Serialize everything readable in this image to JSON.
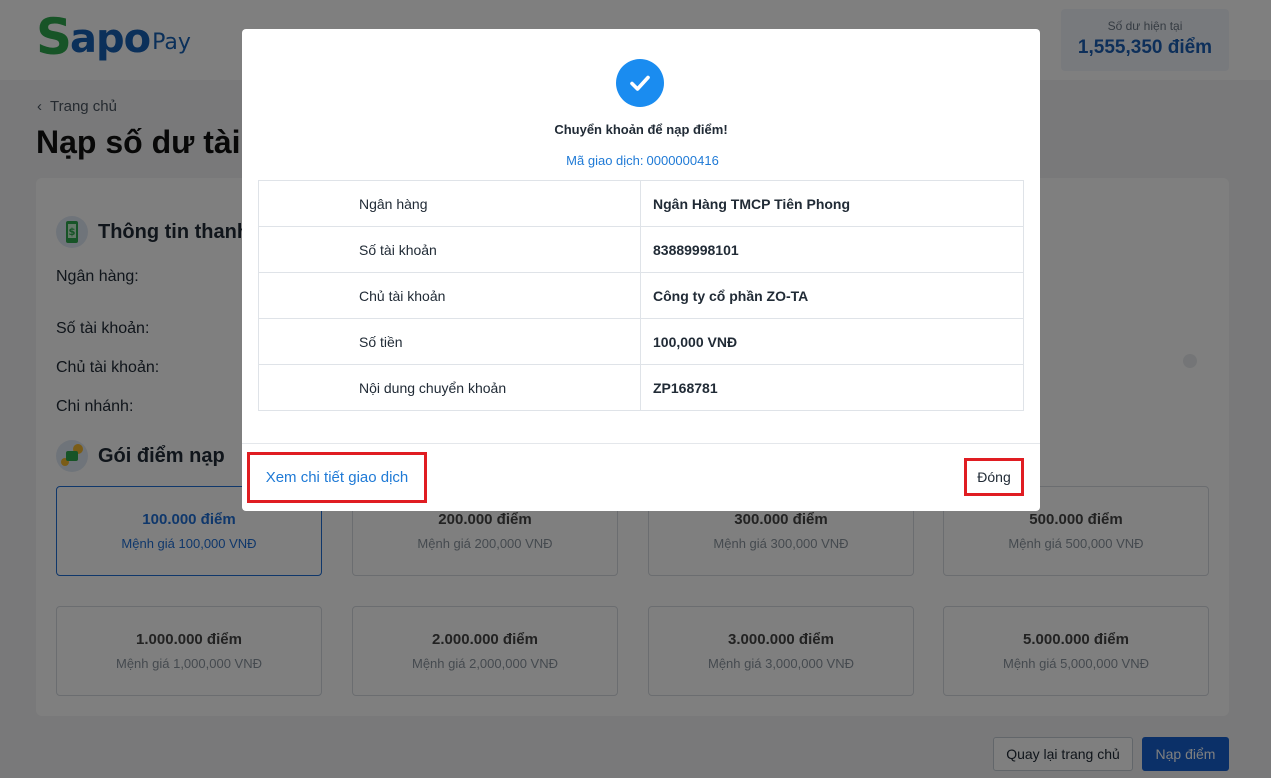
{
  "logo": {
    "s": "S",
    "apo": "apo",
    "pay": "Pay"
  },
  "balance": {
    "label": "Số dư hiện tại",
    "value": "1,555,350 điểm"
  },
  "breadcrumb": {
    "chevron": "‹",
    "label": "Trang chủ"
  },
  "page": {
    "title": "Nạp số dư tài"
  },
  "payment_info": {
    "heading": "Thông tin thanh",
    "rows": [
      "Ngân hàng:",
      "Số tài khoản:",
      "Chủ tài khoản:",
      "Chi nhánh:"
    ]
  },
  "packages": {
    "heading": "Gói điểm nạp",
    "items": [
      {
        "title": "100.000 điểm",
        "sub": "Mệnh giá 100,000 VNĐ"
      },
      {
        "title": "200.000 điểm",
        "sub": "Mệnh giá 200,000 VNĐ"
      },
      {
        "title": "300.000 điểm",
        "sub": "Mệnh giá 300,000 VNĐ"
      },
      {
        "title": "500.000 điểm",
        "sub": "Mệnh giá 500,000 VNĐ"
      },
      {
        "title": "1.000.000 điểm",
        "sub": "Mệnh giá 1,000,000 VNĐ"
      },
      {
        "title": "2.000.000 điểm",
        "sub": "Mệnh giá 2,000,000 VNĐ"
      },
      {
        "title": "3.000.000 điểm",
        "sub": "Mệnh giá 3,000,000 VNĐ"
      },
      {
        "title": "5.000.000 điểm",
        "sub": "Mệnh giá 5,000,000 VNĐ"
      }
    ],
    "selected_index": 0
  },
  "footer": {
    "back_label": "Quay lại trang chủ",
    "topup_label": "Nạp điểm"
  },
  "modal": {
    "title": "Chuyển khoản để nạp điểm!",
    "txn_label": "Mã giao dịch:",
    "txn_code": "0000000416",
    "rows": [
      {
        "key": "Ngân hàng",
        "value": "Ngân Hàng TMCP Tiên Phong"
      },
      {
        "key": "Số tài khoản",
        "value": "83889998101"
      },
      {
        "key": "Chủ tài khoản",
        "value": "Công ty cổ phần ZO-TA"
      },
      {
        "key": "Số tiền",
        "value": "100,000 VNĐ"
      },
      {
        "key": "Nội dung chuyển khoản",
        "value": "ZP168781"
      }
    ],
    "detail_link_label": "Xem chi tiết giao dịch",
    "close_label": "Đóng"
  },
  "colors": {
    "brand_green": "#2fa84f",
    "brand_blue": "#1760b5",
    "success": "#1a8cf0",
    "link": "#1f7ad6",
    "highlight_box": "#e01d22",
    "primary_button": "#1760d0"
  },
  "icons": [
    "chevron-left-icon",
    "payment-phone-icon",
    "coins-icon",
    "check-circle-icon"
  ]
}
